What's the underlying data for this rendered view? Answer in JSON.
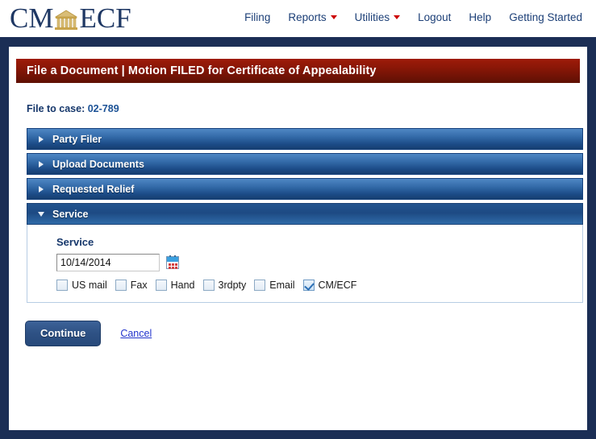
{
  "brand": {
    "logo_prefix": "CM",
    "logo_suffix": "ECF",
    "logo_icon": "courthouse-icon",
    "logo_color": "#1f3864",
    "logo_building_color": "#c9a44c"
  },
  "nav": {
    "items": [
      {
        "label": "Filing",
        "has_dropdown": false
      },
      {
        "label": "Reports",
        "has_dropdown": true
      },
      {
        "label": "Utilities",
        "has_dropdown": true
      },
      {
        "label": "Logout",
        "has_dropdown": false
      },
      {
        "label": "Help",
        "has_dropdown": false
      },
      {
        "label": "Getting Started",
        "has_dropdown": false
      }
    ],
    "link_color": "#1c3f77",
    "caret_color": "#cc0000"
  },
  "page": {
    "title": "File a Document | Motion FILED for Certificate of Appealability",
    "title_bar_color": "#8b1707",
    "frame_color": "#1b2e55"
  },
  "case": {
    "label": "File to case:",
    "number": "02-789"
  },
  "accordion": {
    "sections": [
      {
        "label": "Party Filer",
        "expanded": false,
        "arrow": "chevron-right-icon"
      },
      {
        "label": "Upload Documents",
        "expanded": false,
        "arrow": "chevron-right-icon"
      },
      {
        "label": "Requested Relief",
        "expanded": false,
        "arrow": "chevron-right-icon"
      },
      {
        "label": "Service",
        "expanded": true,
        "arrow": "chevron-down-icon"
      }
    ]
  },
  "service_panel": {
    "legend": "Service",
    "date": {
      "value": "10/14/2014",
      "placeholder": "mm/dd/yyyy",
      "calendar_icon": "calendar-icon"
    },
    "checkboxes": [
      {
        "label": "US mail",
        "checked": false
      },
      {
        "label": "Fax",
        "checked": false
      },
      {
        "label": "Hand",
        "checked": false
      },
      {
        "label": "3rdpty",
        "checked": false
      },
      {
        "label": "Email",
        "checked": false
      },
      {
        "label": "CM/ECF",
        "checked": true
      }
    ]
  },
  "actions": {
    "continue_label": "Continue",
    "cancel_label": "Cancel"
  }
}
